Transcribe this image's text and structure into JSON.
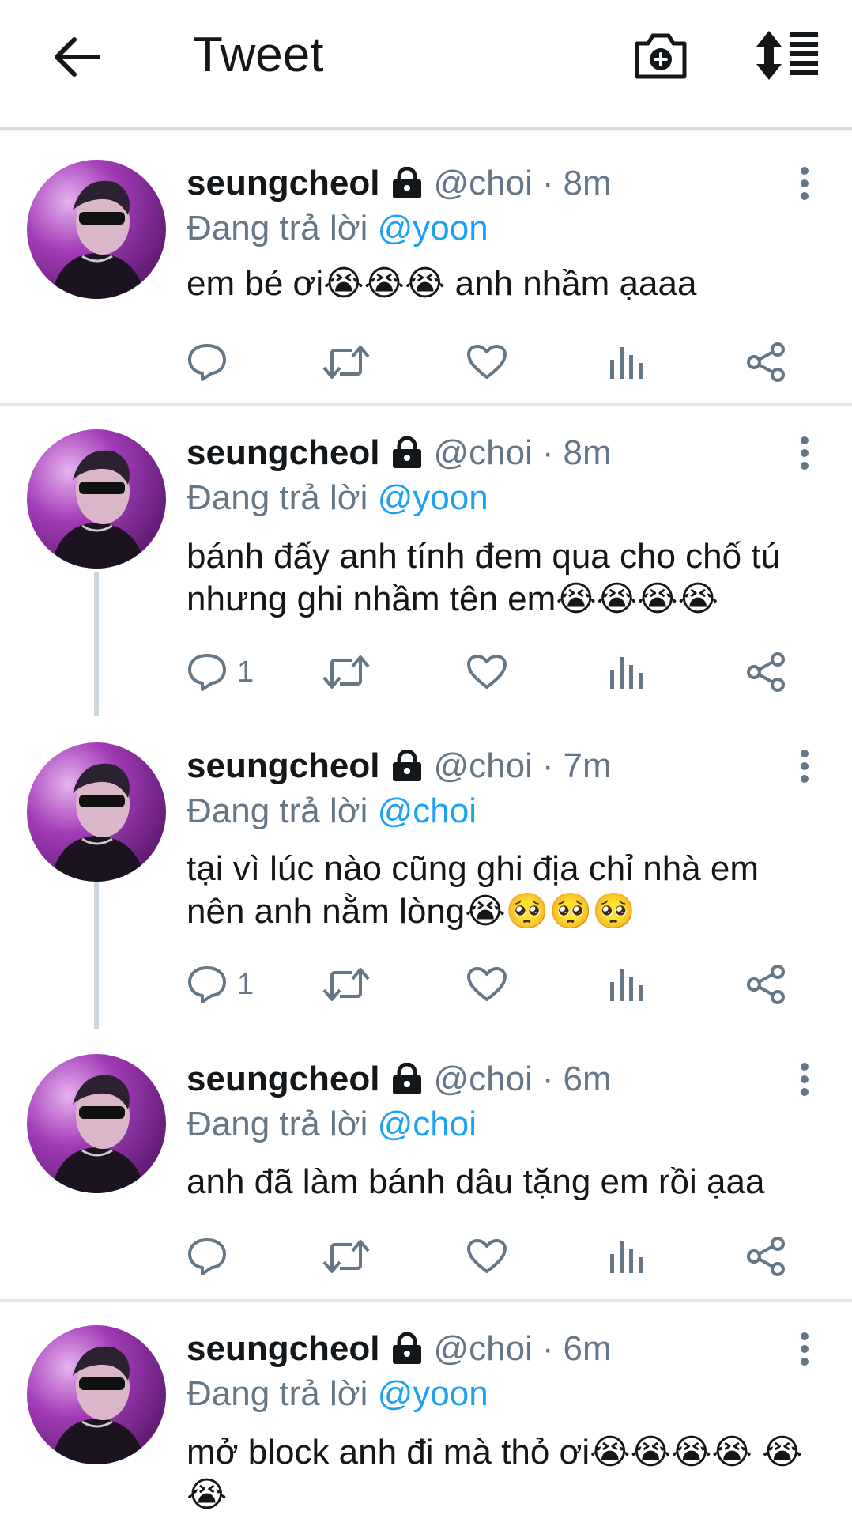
{
  "header": {
    "title": "Tweet"
  },
  "tweets": [
    {
      "name": "seungcheol",
      "handle": "@choi",
      "dot": "·",
      "time": "8m",
      "reply_prefix": "Đang trả lời",
      "reply_to": "@yoon",
      "text": "em bé ơi😭😭😭 anh nhầm ạaaa",
      "reply_count": ""
    },
    {
      "name": "seungcheol",
      "handle": "@choi",
      "dot": "·",
      "time": "8m",
      "reply_prefix": "Đang trả lời",
      "reply_to": "@yoon",
      "text": "bánh đấy anh tính đem qua cho chố tú nhưng ghi nhầm tên em😭😭😭😭",
      "reply_count": "1"
    },
    {
      "name": "seungcheol",
      "handle": "@choi",
      "dot": "·",
      "time": "7m",
      "reply_prefix": "Đang trả lời",
      "reply_to": "@choi",
      "text": "tại vì lúc nào cũng ghi địa chỉ nhà em nên anh nằm lòng😭🥺🥺🥺",
      "reply_count": "1"
    },
    {
      "name": "seungcheol",
      "handle": "@choi",
      "dot": "·",
      "time": "6m",
      "reply_prefix": "Đang trả lời",
      "reply_to": "@choi",
      "text": "anh đã làm bánh dâu tặng em rồi ạaa",
      "reply_count": ""
    },
    {
      "name": "seungcheol",
      "handle": "@choi",
      "dot": "·",
      "time": "6m",
      "reply_prefix": "Đang trả lời",
      "reply_to": "@yoon",
      "text": "mở block anh đi mà thỏ ơi😭😭😭😭 😭😭",
      "reply_count": ""
    }
  ],
  "icons": {
    "back": "arrow-left-icon",
    "camera": "camera-plus-icon",
    "sort": "sort-list-icon",
    "lock": "lock-icon",
    "more": "more-vertical-icon",
    "reply": "reply-icon",
    "retweet": "retweet-icon",
    "like": "heart-icon",
    "stats": "stats-icon",
    "share": "share-icon"
  },
  "colors": {
    "link": "#1da1f2",
    "secondary_text": "#657786",
    "primary_text": "#14171a",
    "divider": "#e1e8ed",
    "thread_line": "#ccd6dd"
  }
}
